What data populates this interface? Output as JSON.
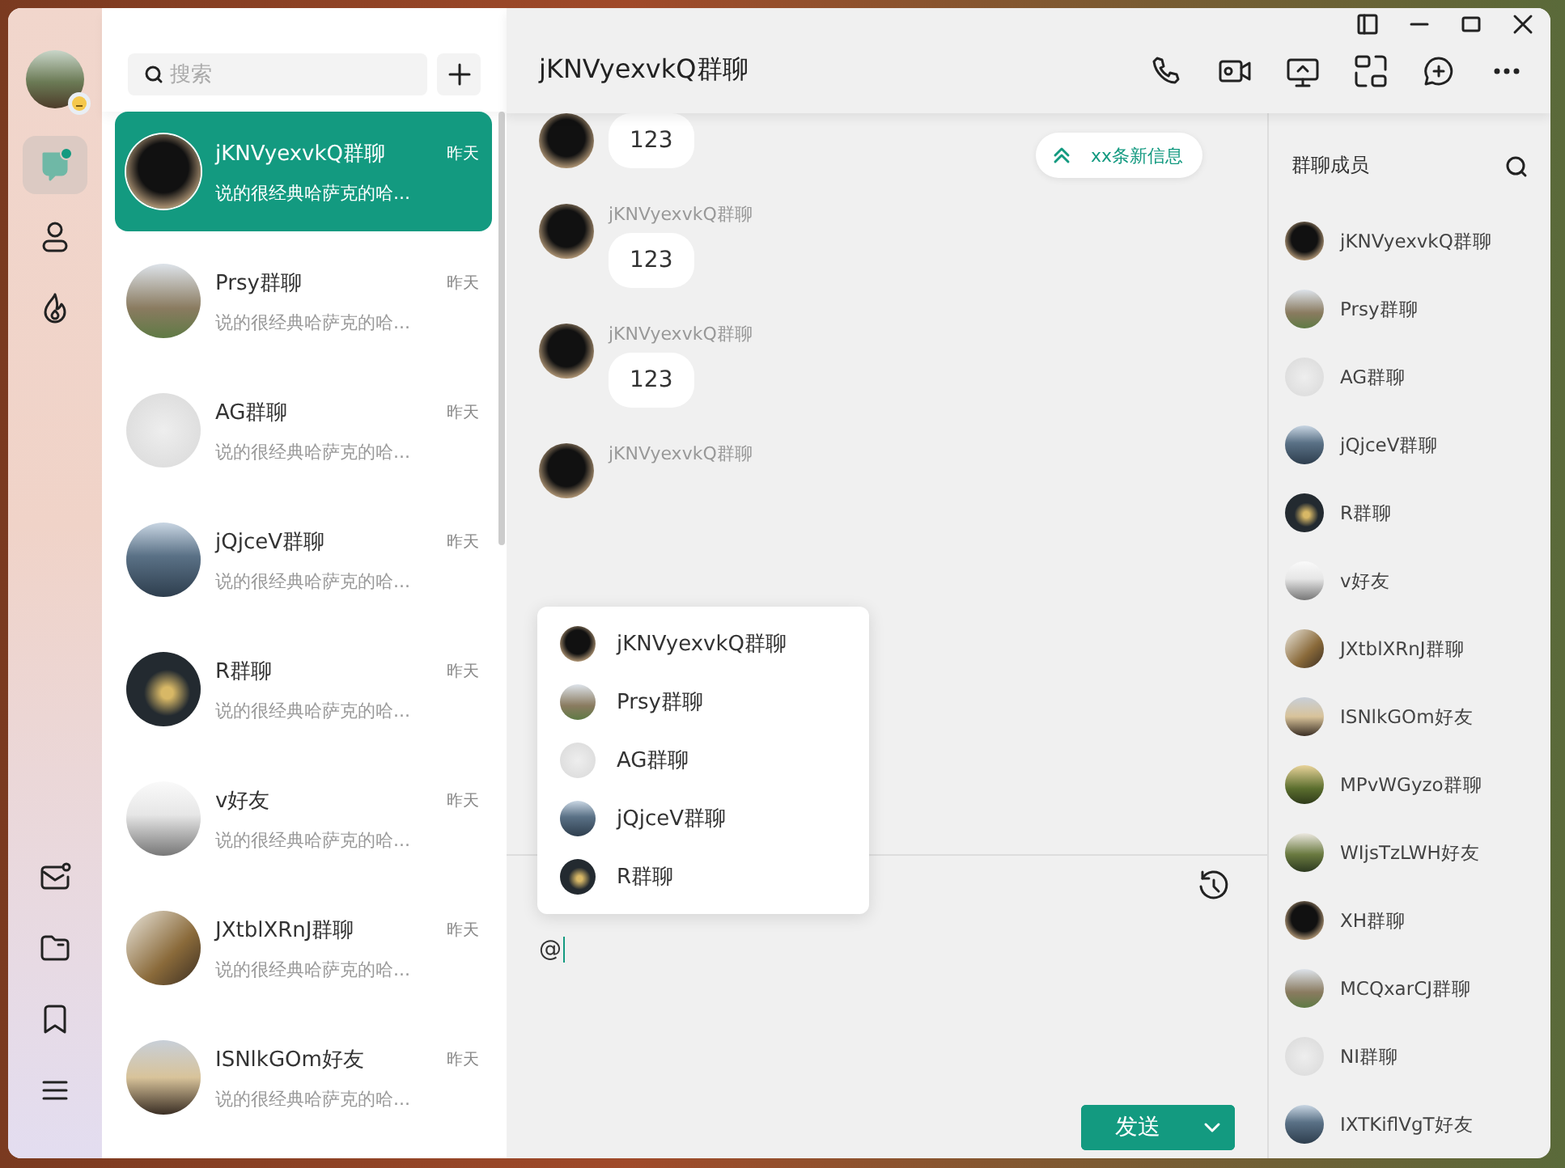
{
  "window": {
    "title": "jKNVyexvkQ群聊"
  },
  "nav_rail": {
    "items": [
      {
        "kind": "chat",
        "selected": true,
        "unread": true
      },
      {
        "kind": "contacts",
        "selected": false
      },
      {
        "kind": "moments",
        "selected": false
      }
    ],
    "bottom_items": [
      {
        "kind": "mail"
      },
      {
        "kind": "files"
      },
      {
        "kind": "favorites"
      },
      {
        "kind": "menu"
      }
    ]
  },
  "search": {
    "placeholder": "搜索"
  },
  "conversations": [
    {
      "name": "jKNVyexvkQ群聊",
      "time": "昨天",
      "preview": "说的很经典哈萨克的哈...",
      "selected": true
    },
    {
      "name": "Prsy群聊",
      "time": "昨天",
      "preview": "说的很经典哈萨克的哈...",
      "selected": false
    },
    {
      "name": "AG群聊",
      "time": "昨天",
      "preview": "说的很经典哈萨克的哈...",
      "selected": false
    },
    {
      "name": "jQjceV群聊",
      "time": "昨天",
      "preview": "说的很经典哈萨克的哈...",
      "selected": false
    },
    {
      "name": "R群聊",
      "time": "昨天",
      "preview": "说的很经典哈萨克的哈...",
      "selected": false
    },
    {
      "name": "v好友",
      "time": "昨天",
      "preview": "说的很经典哈萨克的哈...",
      "selected": false
    },
    {
      "name": "JXtblXRnJ群聊",
      "time": "昨天",
      "preview": "说的很经典哈萨克的哈...",
      "selected": false
    },
    {
      "name": "ISNlkGOm好友",
      "time": "昨天",
      "preview": "说的很经典哈萨克的哈...",
      "selected": false
    }
  ],
  "messages": [
    {
      "text": "123"
    },
    {
      "sender": "jKNVyexvkQ群聊",
      "text": "123"
    },
    {
      "sender": "jKNVyexvkQ群聊",
      "text": "123"
    },
    {
      "sender": "jKNVyexvkQ群聊"
    }
  ],
  "new_messages_pill": "xx条新信息",
  "mention_popup": [
    "jKNVyexvkQ群聊",
    "Prsy群聊",
    "AG群聊",
    "jQjceV群聊",
    "R群聊"
  ],
  "composer": {
    "value": "@",
    "send_label": "发送"
  },
  "members": {
    "title": "群聊成员",
    "items": [
      "jKNVyexvkQ群聊",
      "Prsy群聊",
      "AG群聊",
      "jQjceV群聊",
      "R群聊",
      "v好友",
      "JXtblXRnJ群聊",
      "ISNlkGOm好友",
      "MPvWGyzo群聊",
      "WIjsTzLWH好友",
      "XH群聊",
      "MCQxarCJ群聊",
      "NI群聊",
      "IXTKiflVgT好友"
    ]
  }
}
